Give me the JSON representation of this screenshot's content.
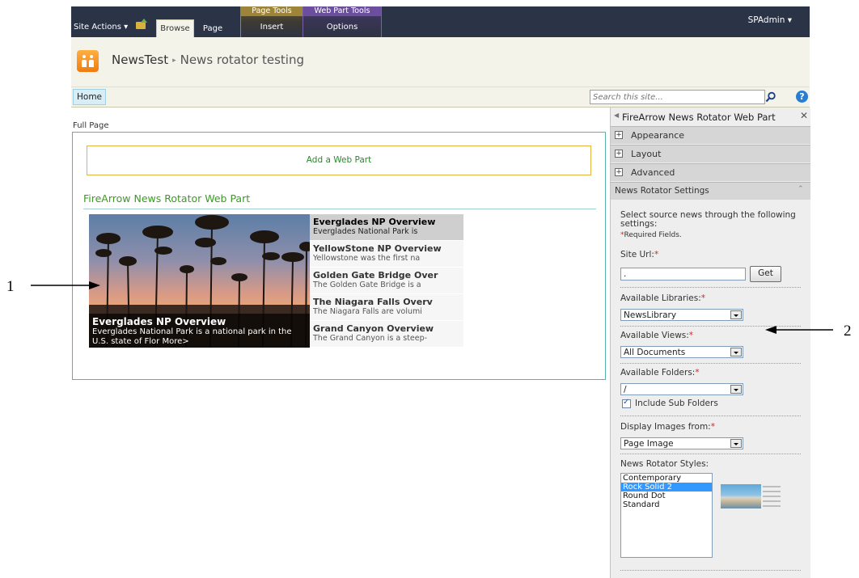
{
  "ribbon": {
    "site_actions": "Site Actions ▾",
    "tabs": {
      "browse": "Browse",
      "page": "Page"
    },
    "contextual": [
      {
        "group": "Page Tools",
        "tab": "Insert"
      },
      {
        "group": "Web Part Tools",
        "tab": "Options"
      }
    ],
    "user": "SPAdmin ▾"
  },
  "breadcrumb": {
    "site": "NewsTest",
    "separator": "▸",
    "page": "News rotator testing"
  },
  "topnav": {
    "home": "Home"
  },
  "search": {
    "placeholder": "Search this site..."
  },
  "main": {
    "zone_label": "Full Page",
    "add_webpart": "Add a Web Part",
    "webpart_title": "FireArrow News Rotator Web Part"
  },
  "rotator": {
    "caption_title": "Everglades NP Overview",
    "caption_text": "Everglades National Park is a national park in the U.S. state of Flor More>",
    "items": [
      {
        "title": "Everglades NP Overview",
        "desc": "Everglades National Park is",
        "active": true
      },
      {
        "title": "YellowStone NP Overview",
        "desc": "Yellowstone was the first na",
        "active": false
      },
      {
        "title": "Golden Gate Bridge Over",
        "desc": "The Golden Gate Bridge is a",
        "active": false
      },
      {
        "title": "The Niagara Falls Overv",
        "desc": "The Niagara Falls are volumi",
        "active": false
      },
      {
        "title": "Grand Canyon Overview",
        "desc": "The Grand Canyon is a steep-",
        "active": false
      }
    ]
  },
  "toolpane": {
    "title": "FireArrow News Rotator Web Part",
    "sections": [
      "Appearance",
      "Layout",
      "Advanced"
    ],
    "settings_header": "News Rotator Settings",
    "intro": "Select source news through the following settings:",
    "required_note": "Required Fields.",
    "site_url_label": "Site Url:",
    "site_url_value": ".",
    "get_button": "Get",
    "libraries_label": "Available Libraries:",
    "libraries_value": "NewsLibrary",
    "views_label": "Available Views:",
    "views_value": "All Documents",
    "folders_label": "Available Folders:",
    "folders_value": "/",
    "include_sub": "Include Sub Folders",
    "include_sub_checked": true,
    "images_label": "Display Images from:",
    "images_value": "Page Image",
    "styles_label": "News Rotator Styles:",
    "styles": [
      "Contemporary",
      "Rock Solid 2",
      "Round Dot",
      "Standard"
    ],
    "styles_selected": "Rock Solid 2"
  },
  "annotations": {
    "one": "1",
    "two": "2"
  },
  "colors": {
    "ribbon": "#2b3447",
    "teal_border": "#57b3b0",
    "webpart_title": "#3b9a22",
    "required": "#e02020",
    "selected": "#3399ff"
  }
}
